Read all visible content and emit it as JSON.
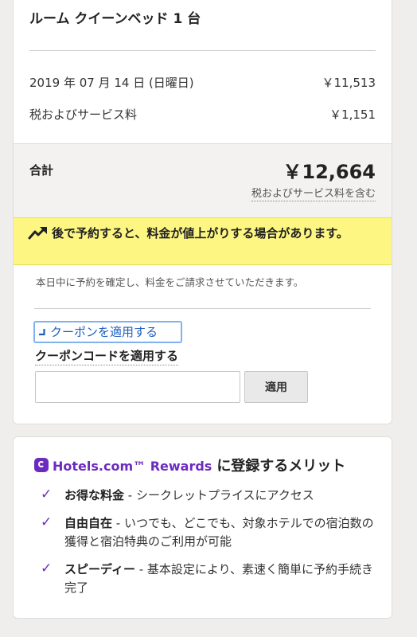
{
  "summary": {
    "room_title": "ルーム クイーンベッド 1 台",
    "rows": [
      {
        "label": "2019 年 07 月 14 日 (日曜日)",
        "value": "￥11,513"
      },
      {
        "label": "税およびサービス料",
        "value": "￥1,151"
      }
    ],
    "total": {
      "label": "合計",
      "value": "￥12,664",
      "note": "税およびサービス料を含む"
    },
    "alert": {
      "icon": "trending-up-icon",
      "text": "後で予約すると、料金が値上がりする場合があります。",
      "background": "#fdf683"
    },
    "notice": "本日中に予約を確定し、料金をご請求させていただきます。",
    "coupon": {
      "toggle_label": "クーポンを適用する",
      "heading": "クーポンコードを適用する",
      "input_value": "",
      "apply_label": "適用"
    }
  },
  "rewards": {
    "brand": "Hotels.com™ Rewards",
    "title_rest": "に登録するメリット",
    "brand_color": "#6c2bbf",
    "benefits": [
      {
        "title": "お得な料金",
        "desc": " - シークレットプライスにアクセス"
      },
      {
        "title": "自由自在",
        "desc": " - いつでも、どこでも、対象ホテルでの宿泊数の獲得と宿泊特典のご利用が可能"
      },
      {
        "title": "スピーディー",
        "desc": " - 基本設定により、素速く簡単に予約手続き完了"
      }
    ]
  }
}
